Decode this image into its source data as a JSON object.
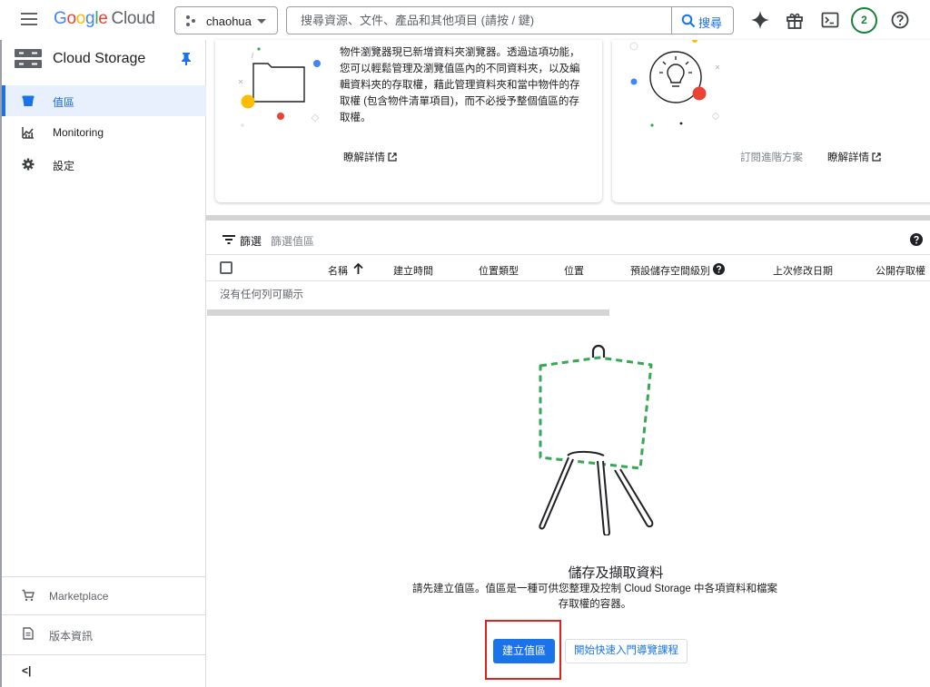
{
  "topbar": {
    "logo_google": [
      "G",
      "o",
      "o",
      "g",
      "l",
      "e"
    ],
    "logo_cloud": "Cloud",
    "project_name": "chaohua",
    "search_placeholder": "搜尋資源、文件、產品和其他項目 (請按 / 鍵)",
    "search_button": "搜尋",
    "notification_count": "2",
    "icons": [
      "gemini-sparkle-icon",
      "gift-icon",
      "cloud-shell-icon",
      "help-icon"
    ]
  },
  "sidebar": {
    "product_title": "Cloud Storage",
    "items": [
      {
        "label": "值區",
        "icon": "bucket-icon",
        "active": true
      },
      {
        "label": "Monitoring",
        "icon": "monitoring-icon",
        "active": false
      },
      {
        "label": "設定",
        "icon": "gear-icon",
        "active": false
      }
    ],
    "bottom": [
      {
        "label": "Marketplace",
        "icon": "cart-icon"
      },
      {
        "label": "版本資訊",
        "icon": "release-notes-icon"
      }
    ],
    "collapse_label": "<|"
  },
  "cards": {
    "browser_text": "物件瀏覽器現已新增資料夾瀏覽器。透過這項功能，您可以輕鬆管理及瀏覽值區內的不同資料夾，以及編輯資料夾的存取權，藉此管理資料夾和當中物件的存取權 (包含物件清單項目)，而不必授予整個值區的存取權。",
    "browser_link": "瞭解詳情",
    "right_link_disabled": "訂閱進階方案",
    "right_link": "瞭解詳情"
  },
  "table": {
    "filter_label": "篩選",
    "filter_placeholder": "篩選值區",
    "columns": [
      "名稱",
      "建立時間",
      "位置類型",
      "位置",
      "預設儲存空間級別",
      "上次修改日期",
      "公開存取權"
    ],
    "sort_column": "名稱",
    "empty_message": "沒有任何列可顯示"
  },
  "empty_state": {
    "title": "儲存及擷取資料",
    "description_line1": "請先建立值區。值區是一種可供您整理及控制 Cloud Storage 中各項資料和檔案",
    "description_line2": "存取權的容器。",
    "primary_button": "建立值區",
    "secondary_button": "開始快速入門導覽課程"
  },
  "colors": {
    "primary": "#1a73e8",
    "active_nav_bg": "#e8f0fe",
    "highlight_box": "#e0201b",
    "easel_dash": "#34a853"
  }
}
